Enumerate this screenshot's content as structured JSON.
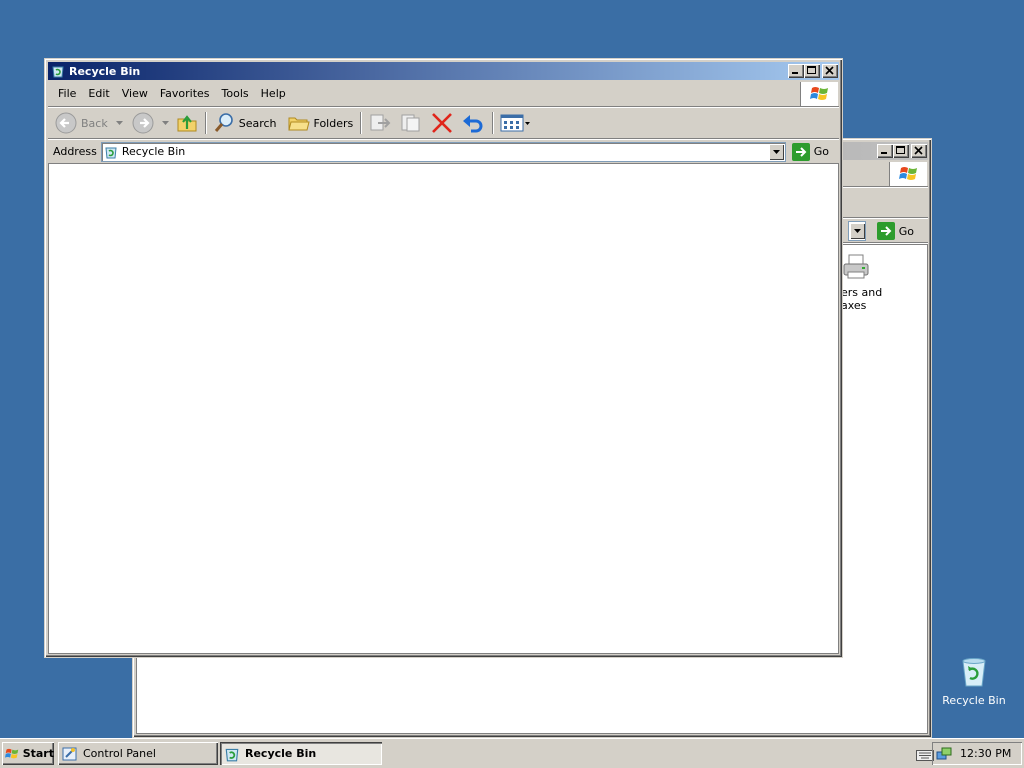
{
  "back_window": {
    "go_label": "Go",
    "partial_icon_label_line1": "ers and",
    "partial_icon_label_line2": "axes"
  },
  "front_window": {
    "title": "Recycle Bin",
    "menu": [
      "File",
      "Edit",
      "View",
      "Favorites",
      "Tools",
      "Help"
    ],
    "toolbar": {
      "back_label": "Back",
      "search_label": "Search",
      "folders_label": "Folders"
    },
    "address": {
      "label": "Address",
      "value": "Recycle Bin",
      "go_label": "Go"
    }
  },
  "desktop": {
    "icons": [
      {
        "label": "Recycle Bin",
        "icon": "recycle-bin-icon"
      }
    ]
  },
  "taskbar": {
    "start_label": "Start",
    "tasks": [
      {
        "label": "Control Panel",
        "icon": "control-panel-icon",
        "active": false
      },
      {
        "label": "Recycle Bin",
        "icon": "recycle-bin-icon",
        "active": true
      }
    ],
    "clock": "12:30 PM"
  },
  "colors": {
    "desktop": "#3a6ea5",
    "title_active": "#0a246a",
    "face": "#d4d0c8"
  }
}
